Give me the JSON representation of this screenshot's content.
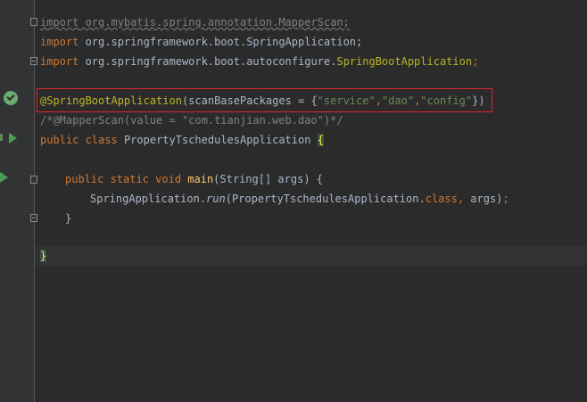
{
  "code": {
    "line1": {
      "import_kw": "import",
      "path": " org.mybatis.spring.annotation.MapperScan;"
    },
    "line2": {
      "import_kw": "import",
      "path": " org.springframework.boot.SpringApplication;"
    },
    "line3": {
      "import_kw": "import",
      "path": " org.springframework.boot.autoconfigure.",
      "cls": "SpringBootApplication",
      "end": ";"
    },
    "line4": {
      "annotation": "@SpringBootApplication",
      "open": "(scanBasePackages = {",
      "s1": "\"service\"",
      "c1": ",",
      "s2": "\"dao\"",
      "c2": ",",
      "s3": "\"config\"",
      "close": "})"
    },
    "line5": {
      "comment": "/*@MapperScan(value = \"com.tianjian.web.dao\")*/"
    },
    "line6": {
      "public_kw": "public",
      "class_kw": " class",
      "name": " PropertyTschedulesApplication ",
      "brace": "{"
    },
    "line7": {
      "mods": "public static void",
      "fn": " main",
      "params": "(String[] args) {"
    },
    "line8": {
      "prefix": "SpringApplication.",
      "run": "run",
      "args_open": "(PropertyTschedulesApplication.",
      "class_kw": "class",
      "comma": ",",
      "args_close": " args)",
      "semi": ";"
    },
    "line9": {
      "brace": "}"
    },
    "line10": {
      "brace": "}"
    }
  },
  "icons": {
    "spring": "spring-bean-icon",
    "run": "run-gutter-icon",
    "fold": "fold-marker-icon"
  },
  "colors": {
    "background": "#2b2b2b",
    "keyword": "#cc7832",
    "annotation": "#bbb529",
    "string": "#6a8759",
    "comment": "#808080",
    "highlight_box": "#e0262a"
  }
}
